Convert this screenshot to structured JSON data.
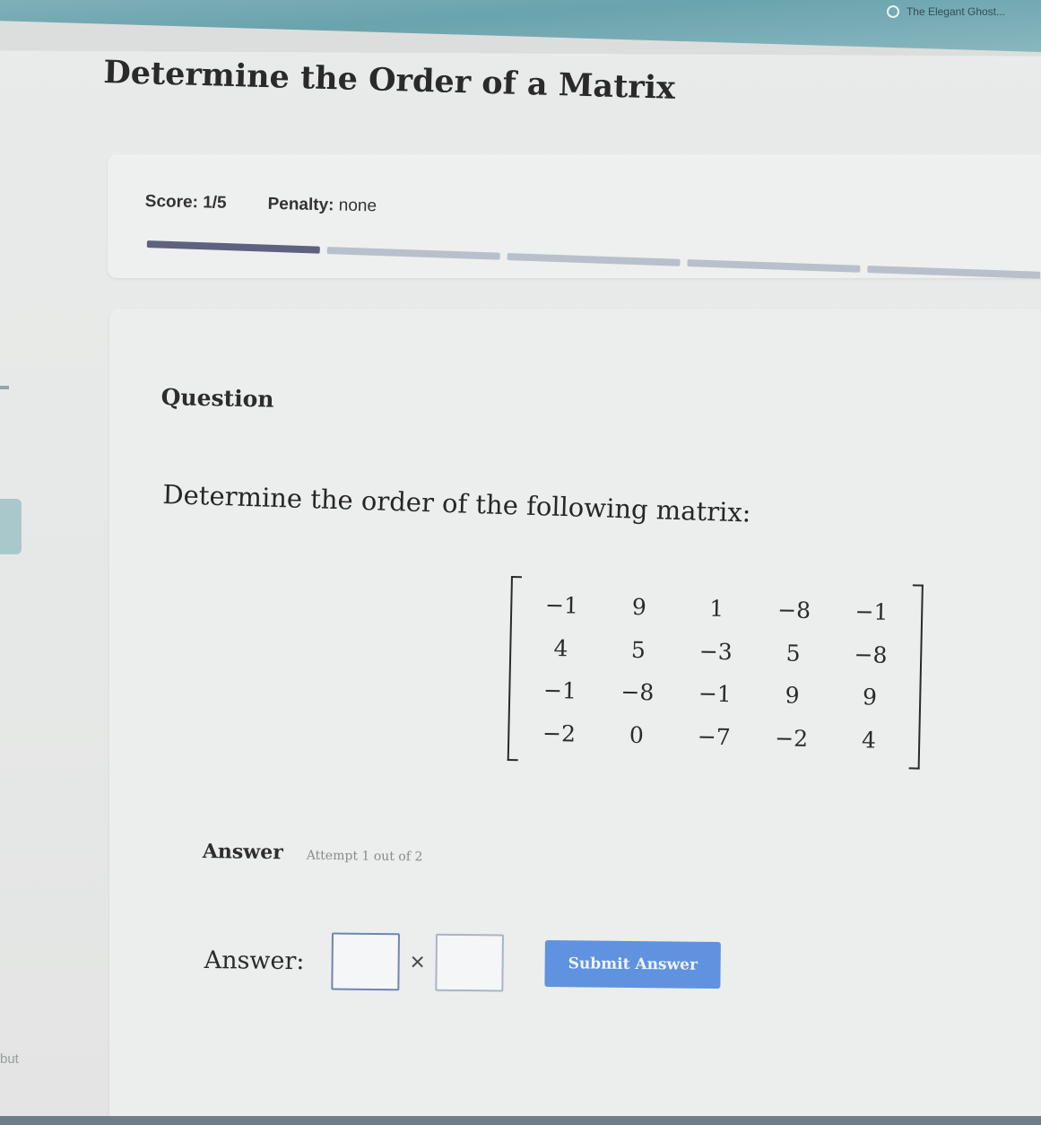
{
  "browser": {
    "tab_label": "The Elegant Ghost..."
  },
  "page": {
    "title": "Determine the Order of a Matrix"
  },
  "score_card": {
    "score_label": "Score: 1/5",
    "penalty_label": "Penalty:",
    "penalty_value": "none",
    "progress": {
      "completed": 1,
      "total": 5
    },
    "colors": {
      "progress_done": "#5e6180",
      "progress_todo": "#b8c0cc"
    }
  },
  "question": {
    "heading": "Question",
    "prompt": "Determine the order of the following matrix:",
    "matrix": [
      [
        "−1",
        "9",
        "1",
        "−8",
        "−1"
      ],
      [
        "4",
        "5",
        "−3",
        "5",
        "−8"
      ],
      [
        "−1",
        "−8",
        "−1",
        "9",
        "9"
      ],
      [
        "−2",
        "0",
        "−7",
        "−2",
        "4"
      ]
    ]
  },
  "answer": {
    "heading": "Answer",
    "attempt_text": "Attempt 1 out of 2",
    "label": "Answer:",
    "rows_value": "",
    "cols_value": "",
    "times_sign": "×",
    "submit_label": "Submit Answer",
    "submit_color": "#5f93e0"
  },
  "edge": {
    "left_text": "but"
  }
}
